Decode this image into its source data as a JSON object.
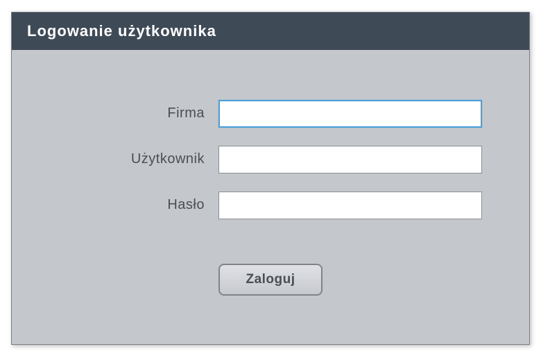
{
  "title": "Logowanie użytkownika",
  "fields": {
    "company": {
      "label": "Firma",
      "value": ""
    },
    "user": {
      "label": "Użytkownik",
      "value": ""
    },
    "password": {
      "label": "Hasło",
      "value": ""
    }
  },
  "actions": {
    "login_label": "Zaloguj"
  },
  "colors": {
    "titlebar_bg": "#3f4a57",
    "panel_bg": "#c4c7cc",
    "focus_border": "#4a9fd8"
  }
}
